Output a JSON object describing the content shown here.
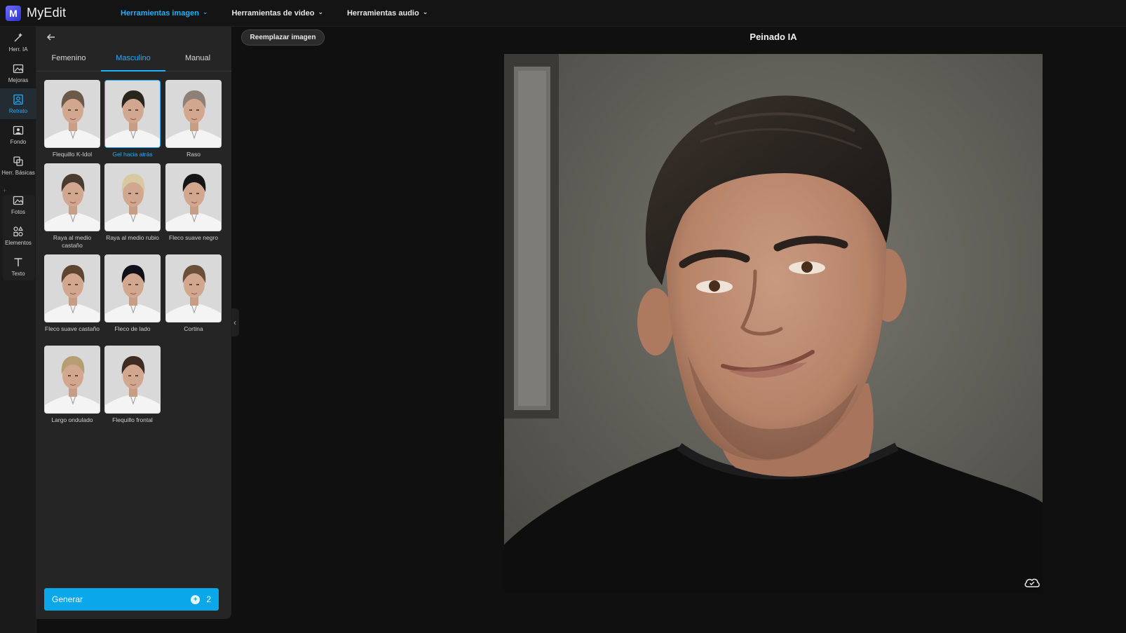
{
  "app": {
    "name": "MyEdit",
    "logo_letter": "M"
  },
  "topnav": [
    {
      "label": "Herramientas imagen",
      "active": true
    },
    {
      "label": "Herramientas de video",
      "active": false
    },
    {
      "label": "Herramientas audio",
      "active": false
    }
  ],
  "rail": [
    {
      "label": "Herr. IA",
      "icon": "magic-wand-icon"
    },
    {
      "label": "Mejoras",
      "icon": "image-enhance-icon"
    },
    {
      "label": "Retrato",
      "icon": "portrait-icon",
      "active": true
    },
    {
      "label": "Fondo",
      "icon": "background-icon"
    },
    {
      "label": "Herr. Básicas",
      "icon": "copy-tools-icon"
    },
    {
      "label": "Fotos",
      "icon": "photos-icon"
    },
    {
      "label": "Elementos",
      "icon": "elements-icon"
    },
    {
      "label": "Texto",
      "icon": "text-icon"
    }
  ],
  "rail_separator": "+",
  "tabs": [
    {
      "label": "Femenino"
    },
    {
      "label": "Masculino",
      "active": true
    },
    {
      "label": "Manual"
    }
  ],
  "styles": [
    {
      "label": "Flequillo K-Idol",
      "hair": "#6b5a4a"
    },
    {
      "label": "Gel hacia atrás",
      "hair": "#2a241f",
      "selected": true
    },
    {
      "label": "Raso",
      "hair": "#8c8077"
    },
    {
      "label": "Raya al medio castaño",
      "hair": "#4a3a30"
    },
    {
      "label": "Raya al medio rubio",
      "hair": "#d8c9a3"
    },
    {
      "label": "Fleco suave negro",
      "hair": "#151518"
    },
    {
      "label": "Fleco suave castaño",
      "hair": "#5e4532"
    },
    {
      "label": "Fleco de lado",
      "hair": "#101018"
    },
    {
      "label": "Cortina",
      "hair": "#6a5038"
    },
    {
      "label": "Largo ondulado",
      "hair": "#b79e72"
    },
    {
      "label": "Flequillo frontal",
      "hair": "#3e2c22"
    }
  ],
  "generate": {
    "label": "Generar",
    "credit_icon": "+",
    "credits": "2"
  },
  "canvas": {
    "replace_label": "Reemplazar imagen",
    "title": "Peinado IA"
  },
  "colors": {
    "accent": "#21b0ff",
    "button": "#0aa7ea"
  }
}
